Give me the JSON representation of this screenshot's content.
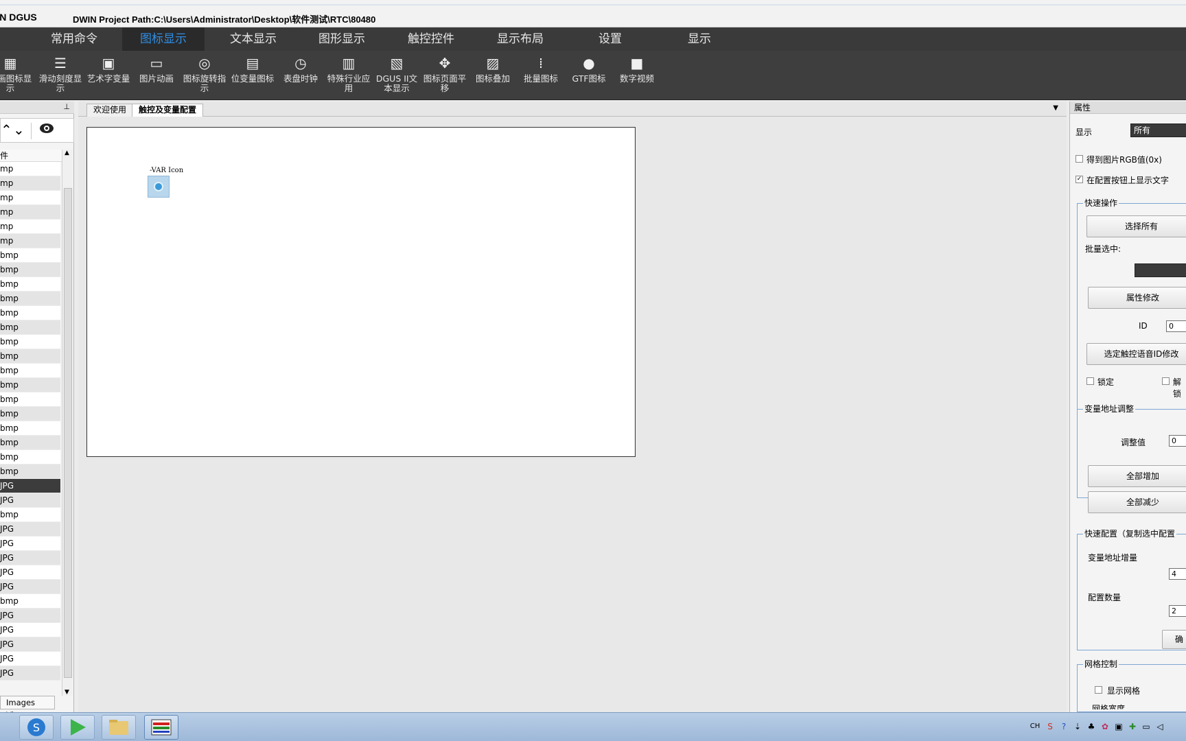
{
  "window": {
    "app_name": "DWIN DGUS",
    "project_path": "DWIN Project Path:C:\\Users\\Administrator\\Desktop\\软件测试\\RTC\\80480"
  },
  "menu": {
    "items": [
      {
        "label": "常用命令"
      },
      {
        "label": "图标显示"
      },
      {
        "label": "文本显示"
      },
      {
        "label": "图形显示"
      },
      {
        "label": "触控控件"
      },
      {
        "label": "显示布局"
      },
      {
        "label": "设置"
      },
      {
        "label": "显示"
      }
    ],
    "active": "图标显示"
  },
  "toolbar": {
    "items": [
      {
        "label": "动画图标显示",
        "icon": "animation-icon"
      },
      {
        "label": "滑动刻度显示",
        "icon": "slider-scale-icon"
      },
      {
        "label": "艺术字变量",
        "icon": "art-text-icon"
      },
      {
        "label": "图片动画",
        "icon": "picture-animation-icon"
      },
      {
        "label": "图标旋转指示",
        "icon": "icon-rotate-icon"
      },
      {
        "label": "位变量图标",
        "icon": "bit-variable-icon"
      },
      {
        "label": "表盘时钟",
        "icon": "clock-icon"
      },
      {
        "label": "特殊行业应用",
        "icon": "special-industry-icon"
      },
      {
        "label": "DGUS II文本显示",
        "icon": "text-file-icon"
      },
      {
        "label": "图标页面平移",
        "icon": "move-arrows-icon"
      },
      {
        "label": "图标叠加",
        "icon": "icon-overlay-icon"
      },
      {
        "label": "批量图标",
        "icon": "batch-icon-icon"
      },
      {
        "label": "GTF图标",
        "icon": "gtf-icon"
      },
      {
        "label": "数字视频",
        "icon": "video-camera-icon"
      }
    ]
  },
  "left_panel": {
    "column_header": "件",
    "files": [
      "mp",
      "mp",
      "mp",
      "mp",
      "mp",
      "mp",
      "bmp",
      "bmp",
      "bmp",
      "bmp",
      "bmp",
      "bmp",
      "bmp",
      "bmp",
      "bmp",
      "bmp",
      "bmp",
      "bmp",
      "bmp",
      "bmp",
      "bmp",
      "bmp",
      "JPG",
      "JPG",
      "bmp",
      "JPG",
      "JPG",
      "JPG",
      "JPG",
      "JPG",
      "bmp",
      "JPG",
      "JPG",
      "JPG",
      "JPG",
      "JPG"
    ],
    "selected_index": 22,
    "bottom_tab": "Images View"
  },
  "documents": {
    "tabs": [
      {
        "label": "欢迎使用"
      },
      {
        "label": "触控及变量配置"
      }
    ],
    "active": "触控及变量配置"
  },
  "canvas": {
    "var_icon_label": "-VAR Icon"
  },
  "properties": {
    "title": "属性",
    "display_label": "显示",
    "display_value": "所有",
    "get_rgb_label": "得到图片RGB值(0x)",
    "get_rgb_checked": false,
    "show_text_label": "在配置按钮上显示文字",
    "show_text_checked": true,
    "quick_ops": {
      "title": "快速操作",
      "select_all": "选择所有",
      "batch_select_label": "批量选中:",
      "modify_attr": "属性修改",
      "id_label": "ID",
      "id_value": "0",
      "voice_id_modify": "选定触控语音ID修改",
      "lock_label": "锁定",
      "unlock_label": "解锁"
    },
    "var_addr": {
      "title": "变量地址调整",
      "adjust_label": "调整值",
      "adjust_value": "0",
      "increase_all": "全部增加",
      "decrease_all": "全部减少"
    },
    "quick_config": {
      "title": "快速配置（复制选中配置",
      "addr_increment_label": "变量地址增量",
      "addr_increment_value": "4",
      "config_count_label": "配置数量",
      "config_count_value": "2",
      "confirm_label": "确"
    },
    "grid": {
      "title": "网格控制",
      "show_grid_label": "显示网格",
      "grid_width_label": "网格宽度"
    }
  },
  "taskbar": {
    "apps": [
      "sogou-browser-icon",
      "media-player-icon",
      "file-manager-icon",
      "dwin-app-icon"
    ],
    "tray_lang": "CH"
  }
}
